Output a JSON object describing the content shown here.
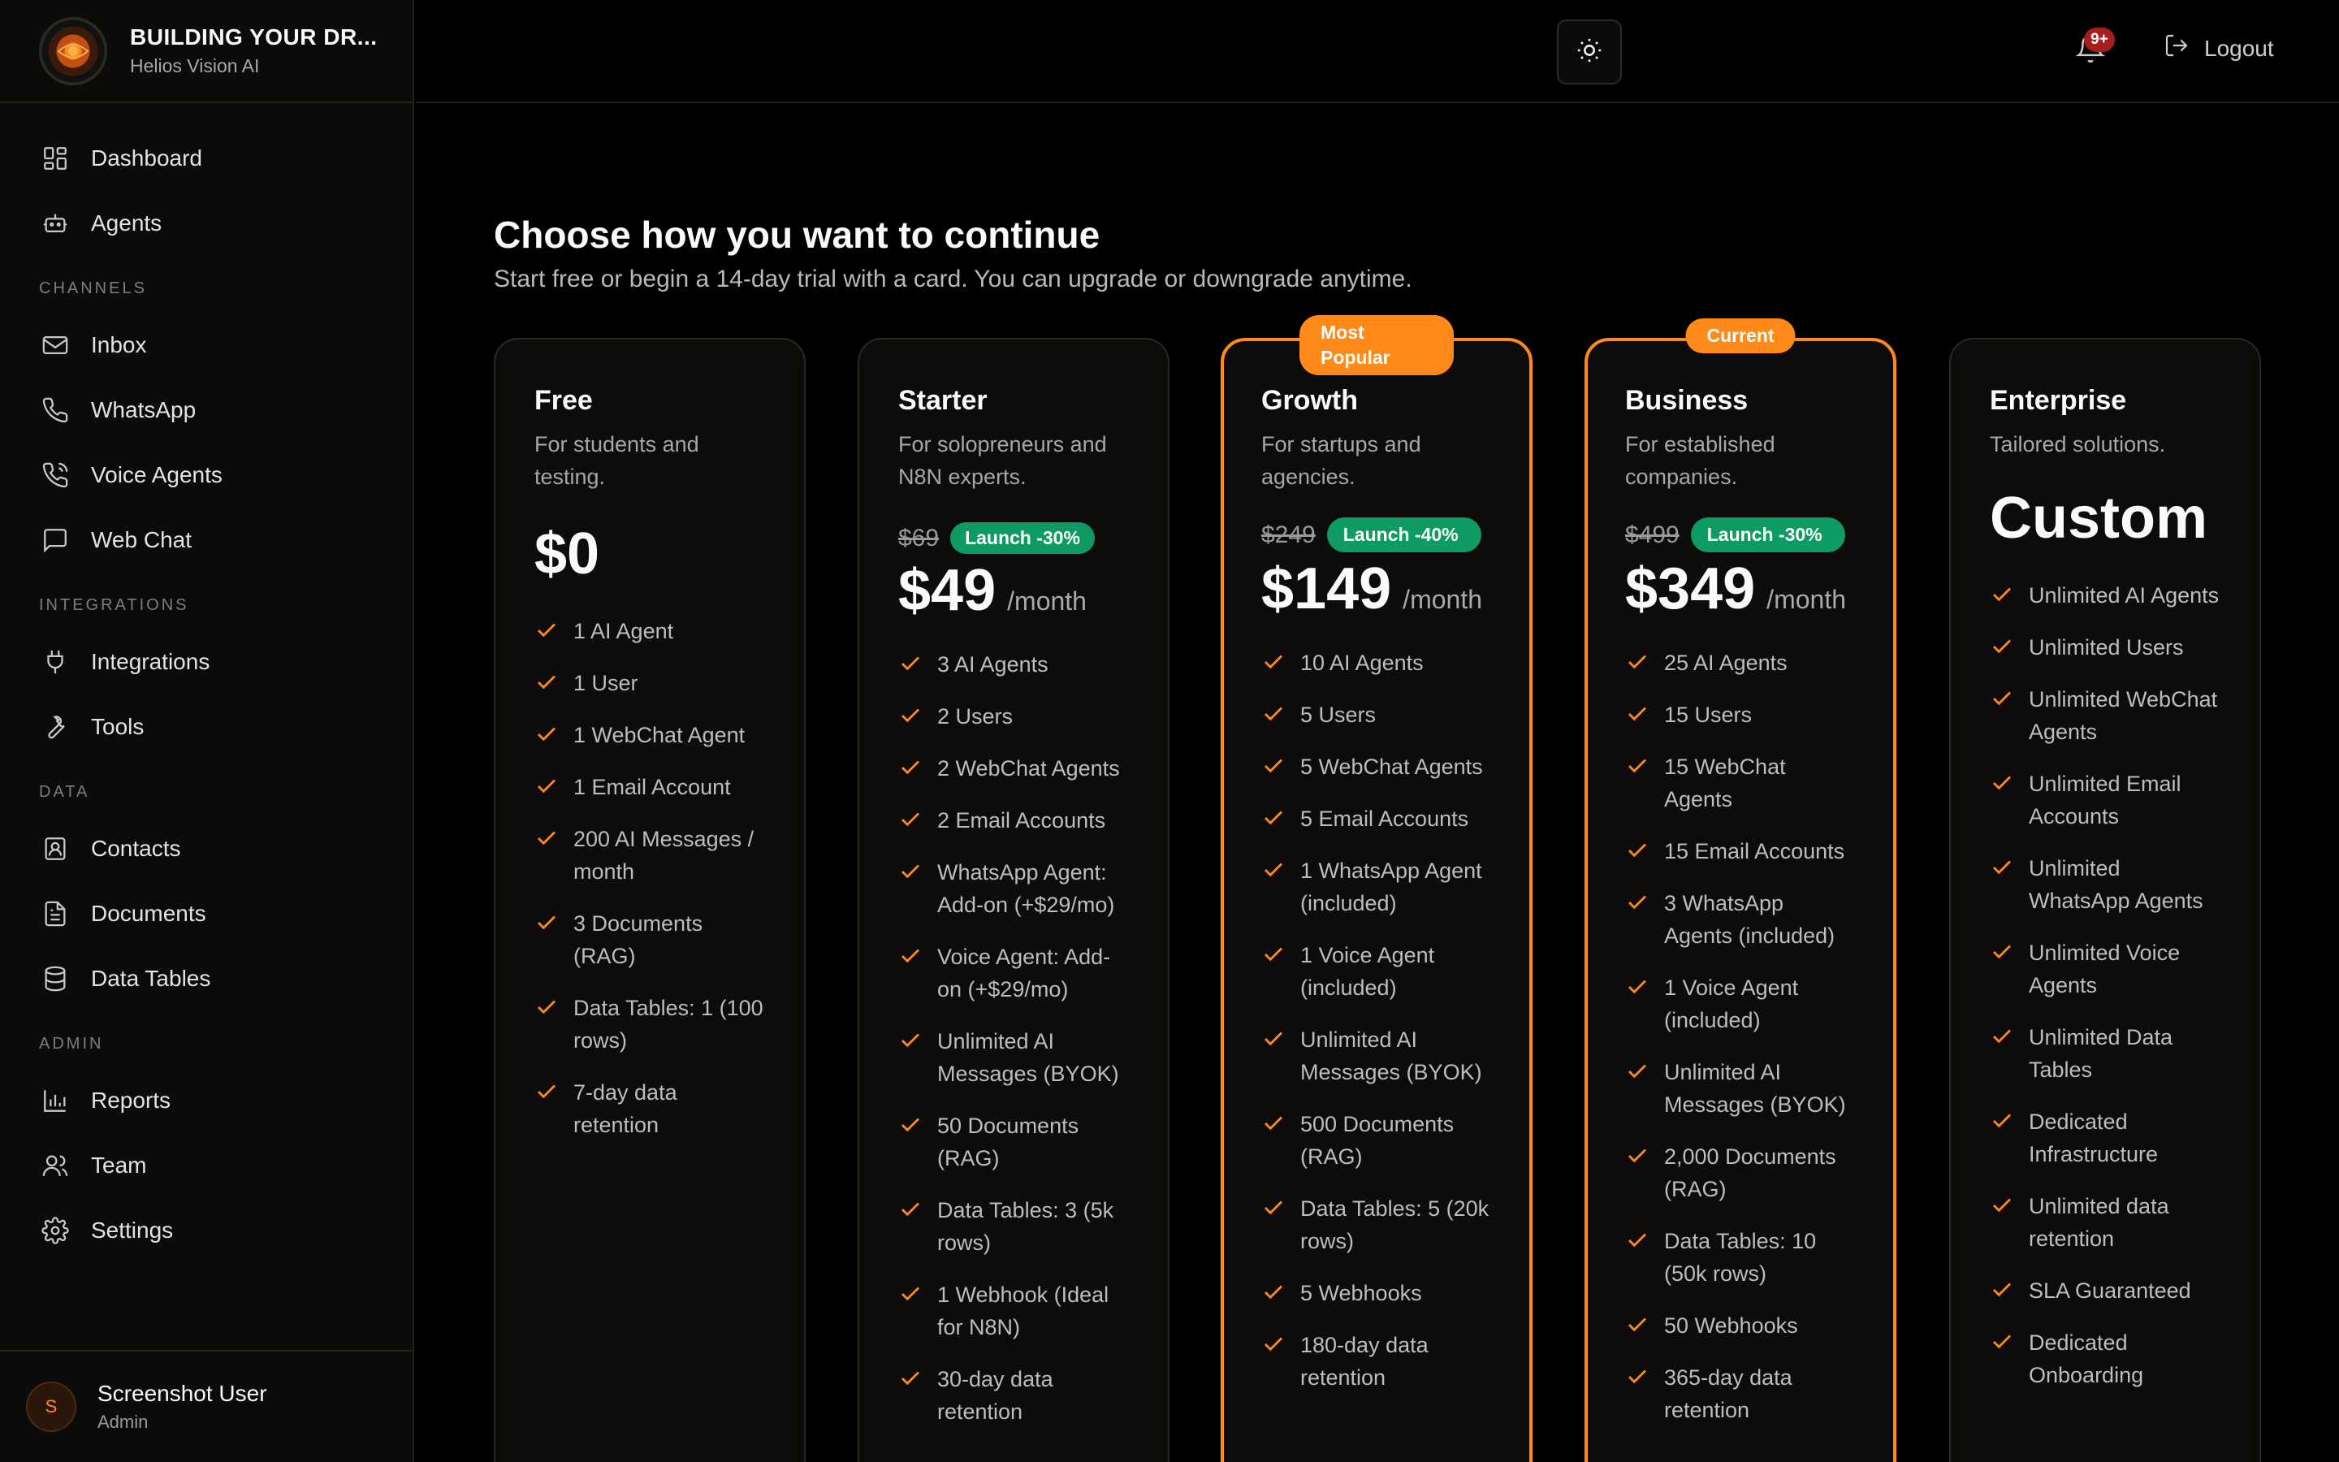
{
  "brand": {
    "title": "BUILDING YOUR DR...",
    "subtitle": "Helios Vision AI"
  },
  "sidebar": {
    "items_top": [
      {
        "label": "Dashboard",
        "icon": "dashboard-icon"
      },
      {
        "label": "Agents",
        "icon": "bot-icon"
      }
    ],
    "sections": [
      {
        "label": "CHANNELS",
        "items": [
          {
            "label": "Inbox",
            "icon": "mail-icon"
          },
          {
            "label": "WhatsApp",
            "icon": "phone-icon"
          },
          {
            "label": "Voice Agents",
            "icon": "phone-call-icon"
          },
          {
            "label": "Web Chat",
            "icon": "chat-icon"
          }
        ]
      },
      {
        "label": "INTEGRATIONS",
        "items": [
          {
            "label": "Integrations",
            "icon": "plug-icon"
          },
          {
            "label": "Tools",
            "icon": "wrench-icon"
          }
        ]
      },
      {
        "label": "DATA",
        "items": [
          {
            "label": "Contacts",
            "icon": "contacts-icon"
          },
          {
            "label": "Documents",
            "icon": "document-icon"
          },
          {
            "label": "Data Tables",
            "icon": "database-icon"
          }
        ]
      },
      {
        "label": "ADMIN",
        "items": [
          {
            "label": "Reports",
            "icon": "bar-chart-icon"
          },
          {
            "label": "Team",
            "icon": "users-icon"
          },
          {
            "label": "Settings",
            "icon": "gear-icon"
          }
        ]
      }
    ]
  },
  "user": {
    "initial": "S",
    "name": "Screenshot User",
    "role": "Admin"
  },
  "header": {
    "notifications_badge": "9+",
    "logout_label": "Logout"
  },
  "main": {
    "title": "Choose how you want to continue",
    "subtitle": "Start free or begin a 14-day trial with a card. You can upgrade or downgrade anytime."
  },
  "plans": [
    {
      "name": "Free",
      "desc": "For students and testing.",
      "price": "$0",
      "features": [
        "1 AI Agent",
        "1 User",
        "1 WebChat Agent",
        "1 Email Account",
        "200 AI Messages / month",
        "3 Documents (RAG)",
        "Data Tables: 1 (100 rows)",
        "7-day data retention"
      ]
    },
    {
      "name": "Starter",
      "desc": "For solopreneurs and N8N experts.",
      "old_price": "$69",
      "launch": "Launch -30%",
      "price": "$49",
      "per": "/month",
      "features": [
        "3 AI Agents",
        "2 Users",
        "2 WebChat Agents",
        "2 Email Accounts",
        "WhatsApp Agent: Add-on (+$29/mo)",
        "Voice Agent: Add-on (+$29/mo)",
        "Unlimited AI Messages (BYOK)",
        "50 Documents (RAG)",
        "Data Tables: 3 (5k rows)",
        "1 Webhook (Ideal for N8N)",
        "30-day data retention"
      ]
    },
    {
      "name": "Growth",
      "badge": "Most Popular",
      "desc": "For startups and agencies.",
      "old_price": "$249",
      "launch": "Launch -40%",
      "price": "$149",
      "per": "/month",
      "features": [
        "10 AI Agents",
        "5 Users",
        "5 WebChat Agents",
        "5 Email Accounts",
        "1 WhatsApp Agent (included)",
        "1 Voice Agent (included)",
        "Unlimited AI Messages (BYOK)",
        "500 Documents (RAG)",
        "Data Tables: 5 (20k rows)",
        "5 Webhooks",
        "180-day data retention"
      ]
    },
    {
      "name": "Business",
      "badge": "Current",
      "desc": "For established companies.",
      "old_price": "$499",
      "launch": "Launch -30%",
      "price": "$349",
      "per": "/month",
      "features": [
        "25 AI Agents",
        "15 Users",
        "15 WebChat Agents",
        "15 Email Accounts",
        "3 WhatsApp Agents (included)",
        "1 Voice Agent (included)",
        "Unlimited AI Messages (BYOK)",
        "2,000 Documents (RAG)",
        "Data Tables: 10 (50k rows)",
        "50 Webhooks",
        "365-day data retention"
      ]
    },
    {
      "name": "Enterprise",
      "desc": "Tailored solutions.",
      "price": "Custom",
      "features": [
        "Unlimited AI Agents",
        "Unlimited Users",
        "Unlimited WebChat Agents",
        "Unlimited Email Accounts",
        "Unlimited WhatsApp Agents",
        "Unlimited Voice Agents",
        "Unlimited Data Tables",
        "Dedicated Infrastructure",
        "Unlimited data retention",
        "SLA Guaranteed",
        "Dedicated Onboarding"
      ]
    }
  ],
  "colors": {
    "accent": "#ff8a1a",
    "launch_green": "#0e9a63",
    "background": "#000000",
    "card": "#0d0c0b"
  }
}
